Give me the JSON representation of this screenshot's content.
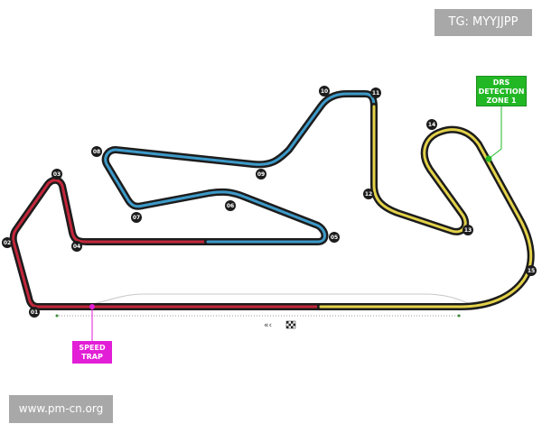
{
  "tag": "TG: MYYJJPP",
  "website": "www.pm-cn.org",
  "drs_label": [
    "DRS",
    "DETECTION",
    "ZONE 1"
  ],
  "speed_trap_label": [
    "SPEED",
    "TRAP"
  ],
  "corners": [
    "01",
    "02",
    "03",
    "04",
    "05",
    "06",
    "07",
    "08",
    "09",
    "10",
    "11",
    "12",
    "13",
    "14",
    "15"
  ],
  "colors": {
    "sector1": "#c4273b",
    "sector2": "#3d9ac9",
    "sector3": "#e3d24a",
    "track_outline": "#1c1c1c",
    "drs": "#22b825",
    "speed_trap": "#e21ed6",
    "label_box": "#a8a8a8"
  }
}
